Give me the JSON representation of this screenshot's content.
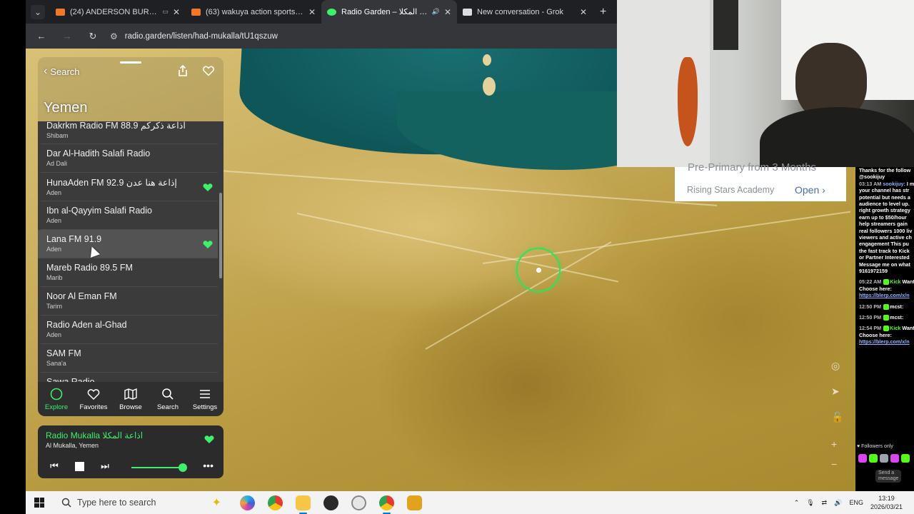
{
  "browser": {
    "tabs": [
      {
        "title": "(24) ANDERSON BURRUS v",
        "favicon_color": "#f0782a",
        "extra": "▭",
        "active": false
      },
      {
        "title": "(63) wakuya action sports park",
        "favicon_color": "#f0782a",
        "extra": "",
        "active": false
      },
      {
        "title": "Radio Garden – اذاعة المكلا",
        "favicon_color": "#3ef06a",
        "extra": "🔊",
        "active": true
      },
      {
        "title": "New conversation - Grok",
        "favicon_color": "#dddddd",
        "extra": "",
        "active": false
      }
    ],
    "new_tab": "+",
    "url": "radio.garden/listen/had-mukalla/tU1qszuw"
  },
  "panel": {
    "back_label": "Search",
    "country": "Yemen",
    "stations": [
      {
        "name": "Dakrkm Radio FM 88.9 اذاعة ذكركم",
        "location": "Shibam",
        "favorite": false
      },
      {
        "name": "Dar Al-Hadith Salafi Radio",
        "location": "Ad Dali",
        "favorite": false
      },
      {
        "name": "HunaAden FM 92.9 إذاعة هنا عدن",
        "location": "Aden",
        "favorite": true
      },
      {
        "name": "Ibn al-Qayyim Salafi Radio",
        "location": "Aden",
        "favorite": false
      },
      {
        "name": "Lana FM 91.9",
        "location": "Aden",
        "favorite": true
      },
      {
        "name": "Mareb Radio 89.5 FM",
        "location": "Marib",
        "favorite": false
      },
      {
        "name": "Noor Al Eman FM",
        "location": "Tarim",
        "favorite": false
      },
      {
        "name": "Radio Aden al-Ghad",
        "location": "Aden",
        "favorite": false
      },
      {
        "name": "SAM FM",
        "location": "Sana'a",
        "favorite": false
      },
      {
        "name": "Sawa Radio",
        "location": "",
        "favorite": false
      }
    ],
    "tabs": {
      "explore": "Explore",
      "favorites": "Favorites",
      "browse": "Browse",
      "search": "Search",
      "settings": "Settings"
    },
    "accent": "#3ef06a"
  },
  "player": {
    "title": "Radio Mukalla اذاعة المكلا",
    "location": "Al Mukalla, Yemen",
    "volume": 0.85
  },
  "ad": {
    "cut_text": "Pre-Primary from 3 Months",
    "name": "Rising Stars Academy",
    "cta": "Open"
  },
  "chat": {
    "messages": [
      {
        "text": "Thanks for the follow"
      },
      {
        "text": "@sookijuy"
      },
      {
        "time": "03:13 AM",
        "user": "sookijuy:",
        "lines": [
          "I m",
          "your channel has str",
          "potential but needs a",
          "audience to level up.",
          "right growth strategy",
          "earn up to $50/hour",
          "help streamers gain",
          "real followers 1000 liv",
          "viewers and active ch",
          "engagement This pu",
          "the fast track to Kick",
          "or Partner Interested",
          "Message me on what",
          "9161972159"
        ]
      },
      {
        "time": "05:22 AM",
        "user": "Kick",
        "lines": [
          "Want to use Sound A",
          "Choose here:"
        ],
        "link": "https://blerp.com/x/n"
      },
      {
        "time": "12:50 PM",
        "user": "mcst:"
      },
      {
        "time": "12:50 PM",
        "user": "mcst:"
      },
      {
        "time": "12:54 PM",
        "user": "Kick",
        "lines": [
          "Want to use Sound A",
          "Choose here:"
        ],
        "link": "https://blerp.com/x/n"
      }
    ],
    "followers_only": "Followers only",
    "send": [
      "Send a",
      "message"
    ]
  },
  "taskbar": {
    "search_placeholder": "Type here to search",
    "lang": "ENG",
    "time": "13:19",
    "date": "2026/03/21"
  }
}
